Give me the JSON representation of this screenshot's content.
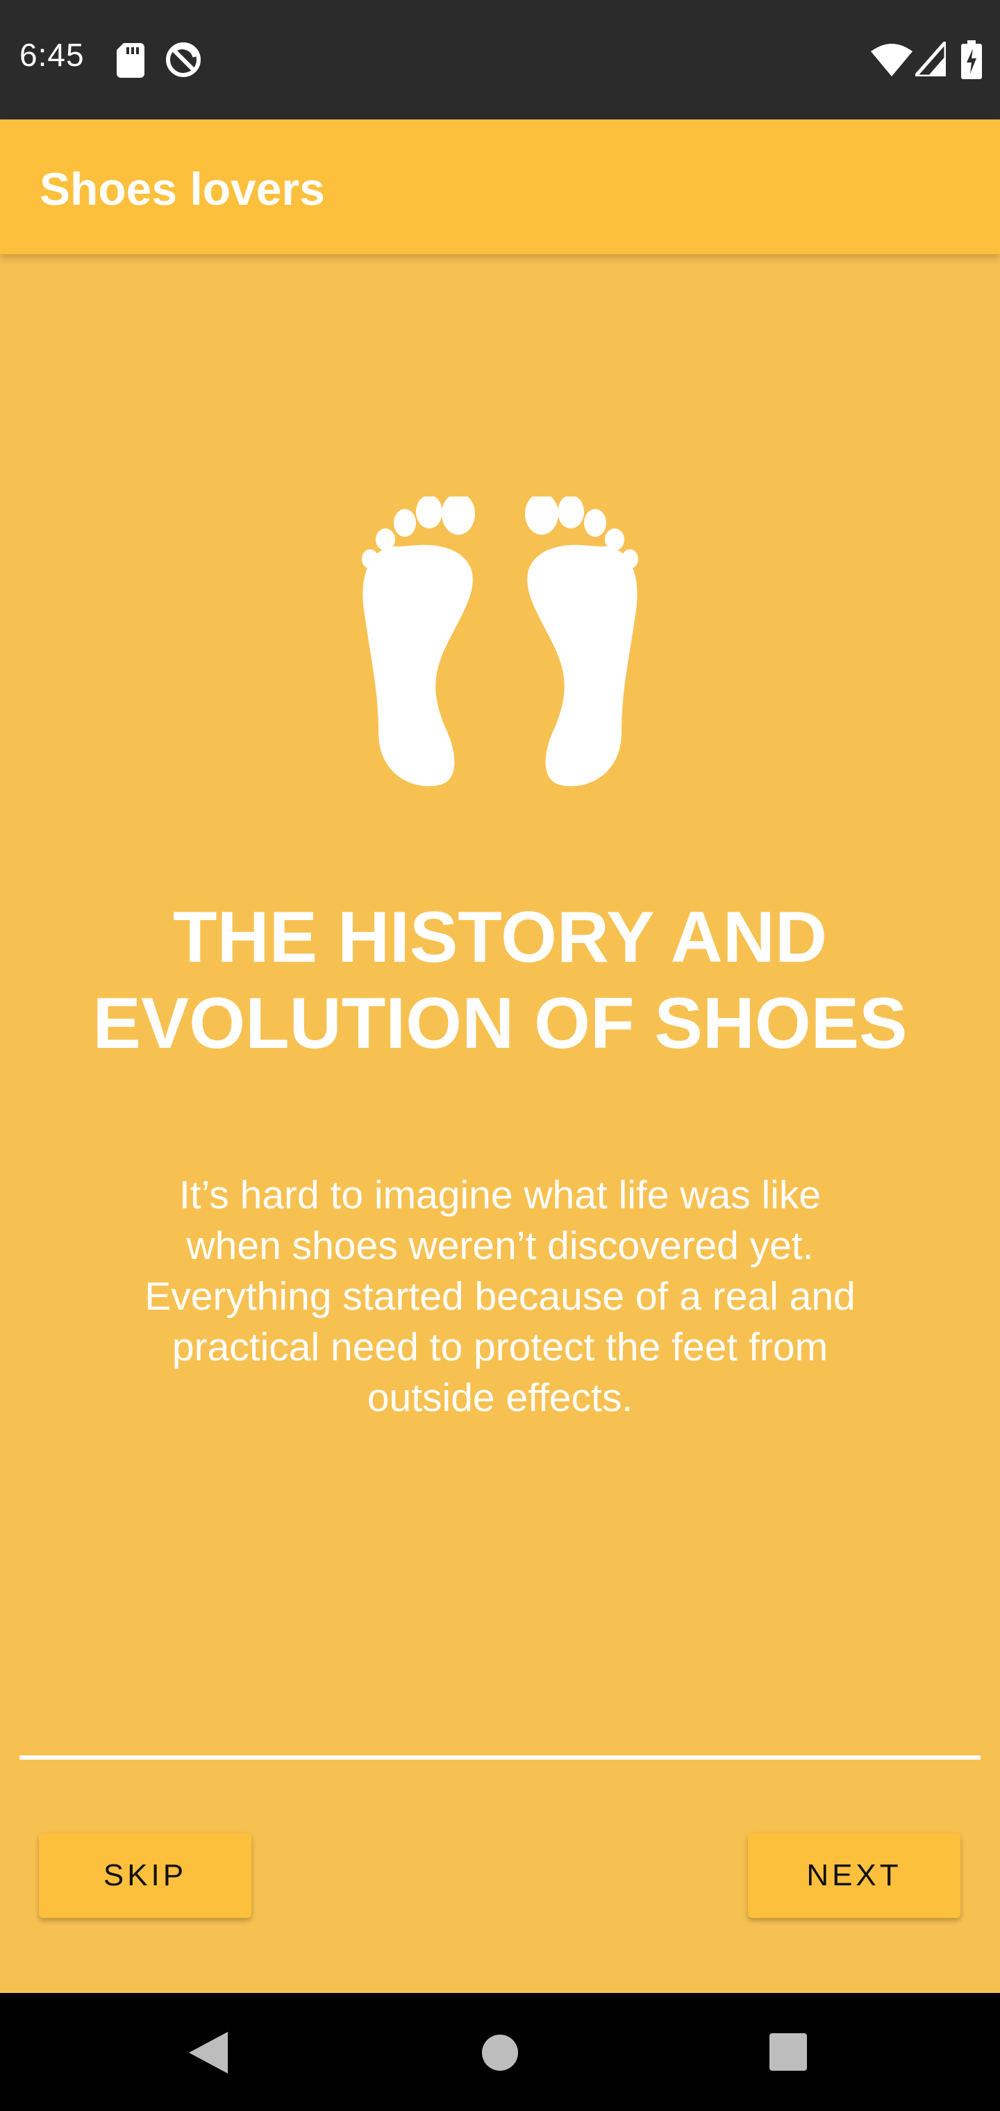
{
  "status_bar": {
    "time": "6:45",
    "icons": [
      "sd-card-icon",
      "sync-disabled-icon",
      "wifi-icon",
      "signal-icon",
      "battery-charging-icon"
    ]
  },
  "app_bar": {
    "title": "Shoes lovers"
  },
  "content": {
    "icon": "feet-icon",
    "headline_line1": "THE HISTORY AND",
    "headline_line2": "EVOLUTION OF SHOES",
    "description": "It’s hard to imagine what life was like when shoes weren’t discovered yet. Everything started because of a real and practical need to protect the feet from outside effects."
  },
  "buttons": {
    "skip_label": "SKIP",
    "next_label": "NEXT"
  },
  "nav_bar": {
    "icons": [
      "back-icon",
      "home-icon",
      "recents-icon"
    ]
  },
  "colors": {
    "background": "#F7C152",
    "app_bar": "#FDC03D",
    "button": "#FDC03D",
    "status_bar": "#2B2B2B",
    "nav_bar": "#000000",
    "text": "#FFFFFF"
  }
}
